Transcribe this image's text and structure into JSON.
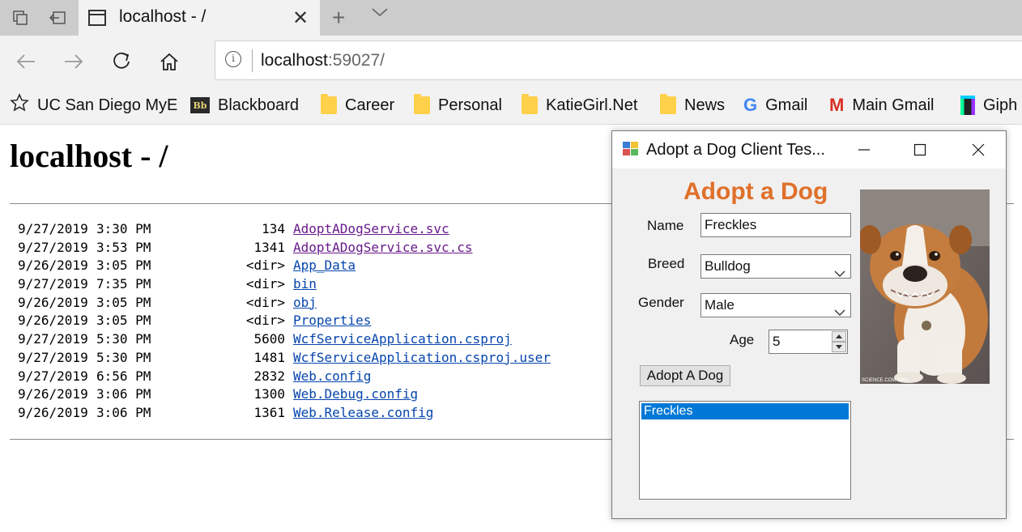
{
  "browser": {
    "tab_title": "localhost - /",
    "address_host": "localhost",
    "address_port": ":59027/",
    "favorites": [
      {
        "label": "UC San Diego MyE",
        "icon": "star-icon"
      },
      {
        "label": "Blackboard",
        "icon": "blackboard-icon"
      },
      {
        "label": "Career",
        "icon": "folder-icon"
      },
      {
        "label": "Personal",
        "icon": "folder-icon"
      },
      {
        "label": "KatieGirl.Net",
        "icon": "folder-icon"
      },
      {
        "label": "News",
        "icon": "folder-icon"
      },
      {
        "label": "Gmail",
        "icon": "google-icon"
      },
      {
        "label": "Main Gmail",
        "icon": "gmail-icon"
      },
      {
        "label": "Giph",
        "icon": "giphy-icon"
      }
    ],
    "bb_glyph": "Bb",
    "google_glyph": "G",
    "gmail_glyph": "M"
  },
  "page": {
    "title": "localhost - /",
    "files": [
      {
        "date": "9/27/2019",
        "time": "3:30 PM",
        "size": "134",
        "name": "AdoptADogService.svc",
        "visited": true
      },
      {
        "date": "9/27/2019",
        "time": "3:53 PM",
        "size": "1341",
        "name": "AdoptADogService.svc.cs",
        "visited": true
      },
      {
        "date": "9/26/2019",
        "time": "3:05 PM",
        "size": "<dir>",
        "name": "App_Data",
        "visited": false
      },
      {
        "date": "9/27/2019",
        "time": "7:35 PM",
        "size": "<dir>",
        "name": "bin",
        "visited": false
      },
      {
        "date": "9/26/2019",
        "time": "3:05 PM",
        "size": "<dir>",
        "name": "obj",
        "visited": false
      },
      {
        "date": "9/26/2019",
        "time": "3:05 PM",
        "size": "<dir>",
        "name": "Properties",
        "visited": false
      },
      {
        "date": "9/27/2019",
        "time": "5:30 PM",
        "size": "5600",
        "name": "WcfServiceApplication.csproj",
        "visited": false
      },
      {
        "date": "9/27/2019",
        "time": "5:30 PM",
        "size": "1481",
        "name": "WcfServiceApplication.csproj.user",
        "visited": false
      },
      {
        "date": "9/27/2019",
        "time": "6:56 PM",
        "size": "2832",
        "name": "Web.config",
        "visited": false
      },
      {
        "date": "9/26/2019",
        "time": "3:06 PM",
        "size": "1300",
        "name": "Web.Debug.config",
        "visited": false
      },
      {
        "date": "9/26/2019",
        "time": "3:06 PM",
        "size": "1361",
        "name": "Web.Release.config",
        "visited": false
      }
    ]
  },
  "dialog": {
    "window_title": "Adopt a Dog Client Tes...",
    "heading": "Adopt a Dog",
    "name_label": "Name",
    "name_value": "Freckles",
    "breed_label": "Breed",
    "breed_value": "Bulldog",
    "gender_label": "Gender",
    "gender_value": "Male",
    "age_label": "Age",
    "age_value": "5",
    "adopt_button": "Adopt A Dog",
    "adopted_list": [
      "Freckles"
    ],
    "photo_caption": "SCIENCE.COM.ORG"
  },
  "colors": {
    "heading": "#e0702a",
    "link": "#0645ad",
    "visited_link": "#681a8a",
    "selection": "#0078d7"
  }
}
